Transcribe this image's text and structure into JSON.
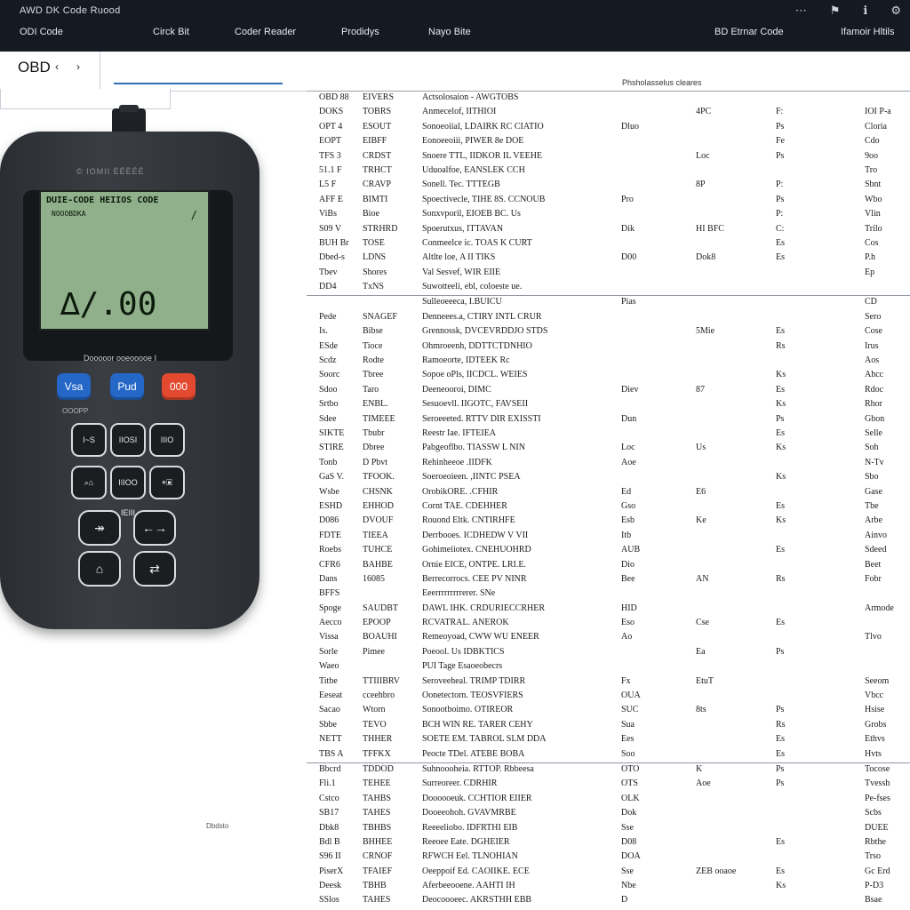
{
  "app": {
    "title": "AWD DK Code Ruood",
    "window_icons": [
      "⋯",
      "⚑",
      "ℹ",
      "⚙"
    ]
  },
  "nav": {
    "items": [
      "ODI Code",
      "Circk Bit",
      "Coder Reader",
      "Prodidys",
      "Nayo Bite",
      "BD Etrnar Code",
      "Ifamoir Hltils"
    ]
  },
  "subnav": {
    "tab_label": "OBD",
    "prev": "‹",
    "next": "›"
  },
  "table": {
    "header": "Phsholasselus cleares",
    "rows": [
      [
        "OBD 88",
        "EIVERS",
        "Actsolosaion - AWGTOBS",
        "",
        "",
        "",
        ""
      ],
      [
        "DOKS",
        "TOBRS",
        "Anmecelof, IITHIOI",
        "",
        "4PC",
        "F:",
        "IOI P-a"
      ],
      [
        "OPT 4",
        "ESOUT",
        "Sonoeoiial, LDAIRK RC CIATIO",
        "Dluo",
        "",
        "Ps",
        "Cloria"
      ],
      [
        "EOPT",
        "EIBFF",
        "Eonoeeoiii, PIWER 8e DOE",
        "",
        "",
        "Fe",
        "Cdo"
      ],
      [
        "TFS 3",
        "CRDST",
        "Snoere TTL, IIDKOR IL VEEHE",
        "",
        "Loc",
        "Ps",
        "9oo"
      ],
      [
        "51.1 F",
        "TRHCT",
        "Uduoalfoe, EANSLEK CCH",
        "",
        "",
        "",
        "Tro"
      ],
      [
        "L5 F",
        "CRAVP",
        "Sonell. Tec. TTTEGB",
        "",
        "8P",
        "P:",
        "Sbnt"
      ],
      [
        "AFF E",
        "BIMTI",
        "Spoectivecle, TIHE 8S. CCNOUB",
        "Pro",
        "",
        "Ps",
        "Wbo"
      ],
      [
        "ViBs",
        "Bioe",
        "Sonxvporil, EIOEB BC. Us",
        "",
        "",
        "P:",
        "Vlin"
      ],
      [
        "S09 V",
        "STRHRD",
        "Spoerutxus, ITTAVAN",
        "Dik",
        "HI BFC",
        "C:",
        "Trilo"
      ],
      [
        "BUH Br",
        "TOSE",
        "Conmeelce ic. TOAS K CURT",
        "",
        "",
        "Es",
        "Cos"
      ],
      [
        "Dbed-s",
        "LDNS",
        "Altlte loe, A II TIKS",
        "D00",
        "Dok8",
        "Es",
        "P.h"
      ],
      [
        "Tbev",
        "Shores",
        "Val Sesvef, WIR EIIE",
        "",
        "",
        "",
        "Ep"
      ],
      [
        "DD4",
        "TxNS",
        "Suwotteeli, ebl, coloeste ue.",
        "",
        "",
        "",
        ""
      ],
      [
        "",
        "",
        "Sulleoeeeca, I.BUICU",
        "Pias",
        "",
        "",
        "CD"
      ],
      [
        "Pede",
        "SNAGEF",
        "Denneees.a, CTIRY INTL CRUR",
        "",
        "",
        "",
        "Sero"
      ],
      [
        "Is.",
        "Bibse",
        "Grennossk, DVCEVRDDJO STDS",
        "",
        "5Mie",
        "Es",
        "Cose"
      ],
      [
        "ESde",
        "Tioce",
        "Ohmroeenh, DDTTCTDNHIO",
        "",
        "",
        "Rs",
        "Irus"
      ],
      [
        "Scdz",
        "Rodte",
        "Ramoeorte, IDTEEK Rc",
        "",
        "",
        "",
        "Aos"
      ],
      [
        "Soorc",
        "Tbree",
        "Sopoe oPls, IICDCL. WEIES",
        "",
        "",
        "Ks",
        "Ahcc"
      ],
      [
        "Sdoo",
        "Taro",
        "Deeneooroi, DIMC",
        "Diev",
        "87",
        "Es",
        "Rdoc"
      ],
      [
        "Srtbo",
        "ENBL.",
        "Sesuoevll. IIGOTC, FAVSEII",
        "",
        "",
        "Ks",
        "Rhor"
      ],
      [
        "Sdee",
        "TIMEEE",
        "Seroeeeted. RTTV DIR EXISSTI",
        "Dun",
        "",
        "Ps",
        "Gbon"
      ],
      [
        "SIKTE",
        "Tbubr",
        "Reestr Iae. IFTEIEA",
        "",
        "",
        "Es",
        "Selle"
      ],
      [
        "STIRE",
        "Dbree",
        "Pabgeoflbo. TIASSW L NIN",
        "Loc",
        "Us",
        "Ks",
        "Soh"
      ],
      [
        "Tonb",
        "D Pbvt",
        "Rehinheeoe .IIDFK",
        "Aoe",
        "",
        "",
        "N-Tv"
      ],
      [
        "GaS V.",
        "TFOOK.",
        "Soeroeoieen. ,IINTC PSEA",
        "",
        "",
        "Ks",
        "Sbo"
      ],
      [
        "Wsbe",
        "CHSNK",
        "OrobikORE. .CFHIR",
        "Ed",
        "E6",
        "",
        "Gase"
      ],
      [
        "ESHD",
        "EHHOD",
        "Cornt TAE. CDEHHER",
        "Gso",
        "",
        "Es",
        "Tbe"
      ],
      [
        "D086",
        "DVOUF",
        "Rouond Eltk. CNTIRHFE",
        "Esb",
        "Ke",
        "Ks",
        "Arbe"
      ],
      [
        "FDTE",
        "TIEEA",
        "Derrbooes. ICDHEDW V VII",
        "Itb",
        "",
        "",
        "Ainvo"
      ],
      [
        "Roebs",
        "TUHCE",
        "Gohimeiiotex. CNEHUOHRD",
        "AUB",
        "",
        "Es",
        "Sdeed"
      ],
      [
        "CFR6",
        "BAHBE",
        "Ornie EICE, ONTPE. LRI.E.",
        "Dio",
        "",
        "",
        "Beet"
      ],
      [
        "Dans",
        "16085",
        "Berrecorrocs. CEE PV NINR",
        "Bee",
        "AN",
        "Rs",
        "Fobr"
      ],
      [
        "BFFS",
        "",
        "Eeerrrrrrrrrerer. SNe",
        "",
        "",
        "",
        ""
      ],
      [
        "Spoge",
        "SAUDBT",
        "DAWL IHK. CRDURIECCRHER",
        "HID",
        "",
        "",
        "Armode"
      ],
      [
        "Aecco",
        "EPOOP",
        "RCVATRAL. ANEROK",
        "Eso",
        "Cse",
        "Es",
        ""
      ],
      [
        "Vissa",
        "BOAUHI",
        "Remeoyoad, CWW WU ENEER",
        "Ao",
        "",
        "",
        "Tlvo"
      ],
      [
        "Sorle",
        "Pimee",
        "Poeool. Us IDBKTICS",
        "",
        "Ea",
        "Ps",
        ""
      ],
      [
        "Waeo",
        "",
        "PUI Tage Esaoeobecrs",
        "",
        "",
        "",
        ""
      ],
      [
        "Titbe",
        "TTIIIBRV",
        "Seroveeheal. TRIMP TDIRR",
        "Fx",
        "EtuT",
        "",
        "Seeom"
      ],
      [
        "Eeseat",
        "cceehbro",
        "Oonetectorn. TEOSVFIERS",
        "OUA",
        "",
        "",
        "Vbcc"
      ],
      [
        "Sacao",
        "Wtorn",
        "Sonootboimo. OTIREOR",
        "SUC",
        "8ts",
        "Ps",
        "Hsise"
      ],
      [
        "Sbbe",
        "TEVO",
        "BCH WIN RE. TARER CEHY",
        "Sua",
        "",
        "Rs",
        "Grobs"
      ],
      [
        "NETT",
        "THHER",
        "SOETE EM. TABROL SLM DDA",
        "Ees",
        "",
        "Es",
        "Ethvs"
      ],
      [
        "TBS A",
        "TFFKX",
        "Peocte TDel. ATEBE BOBA",
        "Soo",
        "",
        "Es",
        "Hvts"
      ],
      [
        "Bbcrd",
        "TDDOD",
        "Suhnoooheia. RTTOP. Rbbeesa",
        "OTO",
        "K",
        "Ps",
        "Tocose"
      ],
      [
        "Fli.1",
        "TEHEE",
        "Surreoreer. CDRHIR",
        "OTS",
        "Aoe",
        "Ps",
        "Tvessh"
      ],
      [
        "Cstco",
        "TAHBS",
        "Doooooeuk. CCHTIOR EIIER",
        "OLK",
        "",
        "",
        "Pe-fses"
      ],
      [
        "SB17",
        "TAHES",
        "Dooeeohoh. GVAVMRBE",
        "Dok",
        "",
        "",
        "Scbs"
      ],
      [
        "Dbk8",
        "TBHBS",
        "Reeeeliobo. IDFRTHI EIB",
        "Sse",
        "",
        "",
        "DUEE"
      ],
      [
        "Bdl B",
        "BHHEE",
        "Reeoee Eate. DGHEIER",
        "D08",
        "",
        "Es",
        "Rbthe"
      ],
      [
        "S96 II",
        "CRNOF",
        "RFWCH Eel. TLNOHIAN",
        "DOA",
        "",
        "",
        "Trso"
      ],
      [
        "PiserX",
        "TFAIEF",
        "Oeeppoif Ed. CAOIIKE. ECE",
        "Sse",
        "ZEB ooaoe",
        "Es",
        "Gc Erd"
      ],
      [
        "Deesk",
        "TBHB",
        "Aferbeeooene. AAHTI IH",
        "Nbe",
        "",
        "Ks",
        "P-D3"
      ],
      [
        "SSlos",
        "TAHES",
        "Deocoooeec. AKRSTHH EBB",
        "D",
        "",
        "",
        "Bsae"
      ]
    ],
    "footnote": "Dbdsto"
  },
  "device": {
    "brand": "© IOMII ÈËËËË",
    "screen_title": "DUIE-CODE HEIIOS  CODE",
    "screen_sub": "NOOOBDKA",
    "screen_mark": "/",
    "screen_value": "∆/.00",
    "label": "Dooooor ooeooooe I",
    "small_label": "OOOPP",
    "buttons": [
      "Vsa",
      "Pud",
      "000"
    ],
    "keys": [
      "I~S",
      "IIOSI\nIIOII",
      "IIIO",
      "⌕⌂",
      "IIIOO\nIEIII",
      "⌖▣",
      "↠",
      "←→",
      "⌂",
      "⇄"
    ]
  },
  "colors": {
    "topbar": "#141a22",
    "accent": "#2f6fb6",
    "button_blue": "#2567c7",
    "button_red": "#e2492f",
    "screen_lcd": "#8fb08a"
  }
}
